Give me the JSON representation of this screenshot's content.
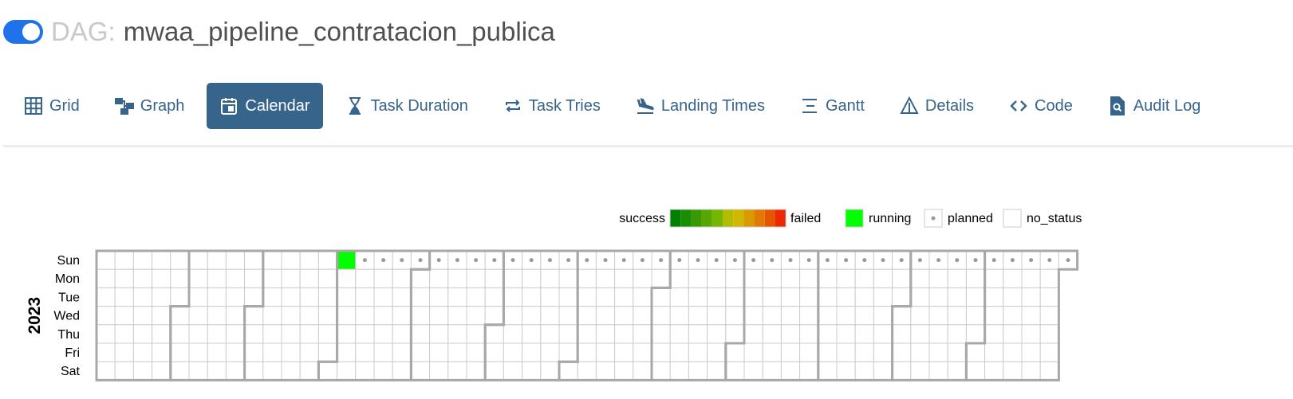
{
  "dag": {
    "prefix": "DAG:",
    "id": "mwaa_pipeline_contratacion_publica",
    "paused": false
  },
  "tabs": [
    {
      "label": "Grid",
      "icon": "grid-icon",
      "active": false
    },
    {
      "label": "Graph",
      "icon": "graph-icon",
      "active": false
    },
    {
      "label": "Calendar",
      "icon": "calendar-icon",
      "active": true
    },
    {
      "label": "Task Duration",
      "icon": "hourglass-icon",
      "active": false
    },
    {
      "label": "Task Tries",
      "icon": "repeat-icon",
      "active": false
    },
    {
      "label": "Landing Times",
      "icon": "plane-landing-icon",
      "active": false
    },
    {
      "label": "Gantt",
      "icon": "gantt-icon",
      "active": false
    },
    {
      "label": "Details",
      "icon": "warning-triangle-icon",
      "active": false
    },
    {
      "label": "Code",
      "icon": "code-icon",
      "active": false
    },
    {
      "label": "Audit Log",
      "icon": "file-search-icon",
      "active": false
    }
  ],
  "legend": {
    "success_label": "success",
    "failed_label": "failed",
    "gradient_colors": [
      "#008000",
      "#1b8d00",
      "#389a00",
      "#56a800",
      "#76b500",
      "#b3bd00",
      "#d1b800",
      "#d99a00",
      "#e07a00",
      "#e65500",
      "#ec2900"
    ],
    "running_label": "running",
    "running_color": "#00ff00",
    "planned_label": "planned",
    "no_status_label": "no_status"
  },
  "calendar": {
    "year_label": "2023",
    "weekday_labels": [
      "Sun",
      "Mon",
      "Tue",
      "Wed",
      "Thu",
      "Fri",
      "Sat"
    ],
    "first_date": "2023-01-01",
    "last_date": "2023-12-31",
    "running_dates": [
      "2023-04-02"
    ],
    "planned_weekday": "Sun",
    "planned_from": "2023-04-09"
  },
  "colors": {
    "accent": "#36648b",
    "toggle_on": "#1f72ea",
    "cell_border": "#cccccc",
    "month_border": "#a8a8a8",
    "planned_dot": "#999999"
  }
}
